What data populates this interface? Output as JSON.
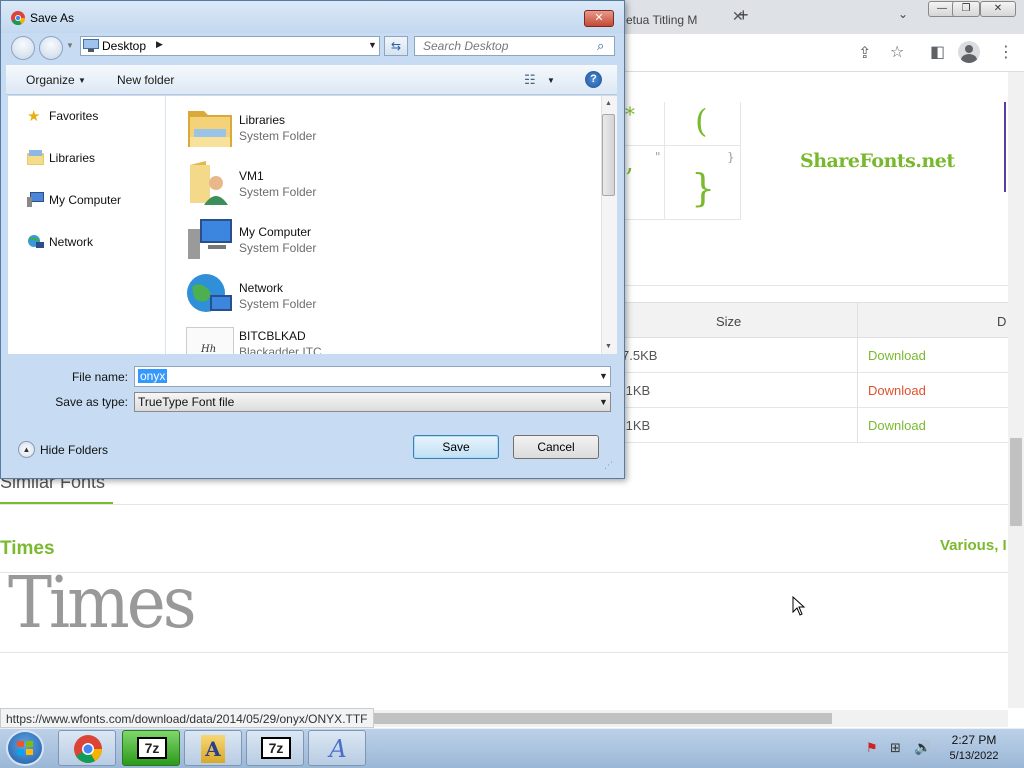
{
  "browser": {
    "tab_title": "etua Titling M",
    "new_tab": "+",
    "toolbar_icons": [
      "share-icon",
      "star-icon",
      "sidepanel-icon",
      "profile-icon",
      "menu-icon"
    ]
  },
  "page": {
    "preview_chars": [
      "*",
      "(",
      "\"",
      "}",
      "’",
      "}"
    ],
    "sharefonts_logo": "ShareFonts.net",
    "table": {
      "headers": [
        "Size",
        "D"
      ],
      "rows": [
        {
          "size": "7.5KB",
          "link": "Download",
          "color": "#7bb92f"
        },
        {
          "size": ".1KB",
          "link": "Download",
          "color": "#e0512b"
        },
        {
          "size": ".1KB",
          "link": "Download",
          "color": "#7bb92f"
        }
      ]
    },
    "similar_heading": "Similar Fonts",
    "font_name": "Times",
    "font_author": "Various, I",
    "font_sample": "Times"
  },
  "status_bar": {
    "url": "https://www.wfonts.com/download/data/2014/05/29/onyx/ONYX.TTF"
  },
  "dialog": {
    "title": "Save As",
    "close_label": "✕",
    "address": "Desktop",
    "search_placeholder": "Search Desktop",
    "toolbar": {
      "organize": "Organize",
      "new_folder": "New folder"
    },
    "nav_items": [
      {
        "label": "Favorites",
        "icon": "star-icon"
      },
      {
        "label": "Libraries",
        "icon": "libraries-icon"
      },
      {
        "label": "My Computer",
        "icon": "computer-icon"
      },
      {
        "label": "Network",
        "icon": "network-icon"
      }
    ],
    "files": [
      {
        "name": "Libraries",
        "type": "System Folder",
        "icon": "libraries-folder-icon"
      },
      {
        "name": "VM1",
        "type": "System Folder",
        "icon": "user-folder-icon"
      },
      {
        "name": "My Computer",
        "type": "System Folder",
        "icon": "computer-icon"
      },
      {
        "name": "Network",
        "type": "System Folder",
        "icon": "network-globe-icon"
      },
      {
        "name": "BITCBLKAD",
        "type": "Blackadder ITC",
        "icon": "font-file-icon"
      }
    ],
    "file_name_label": "File name:",
    "file_name_value": "onyx",
    "save_type_label": "Save as type:",
    "save_type_value": "TrueType Font file",
    "hide_folders": "Hide Folders",
    "save_button": "Save",
    "cancel_button": "Cancel"
  },
  "taskbar": {
    "time": "2:27 PM",
    "date": "5/13/2022",
    "apps": [
      "windows-start-icon",
      "chrome-icon",
      "7zip-icon",
      "font-viewer-icon",
      "7zip-icon",
      "font-app-icon"
    ]
  }
}
